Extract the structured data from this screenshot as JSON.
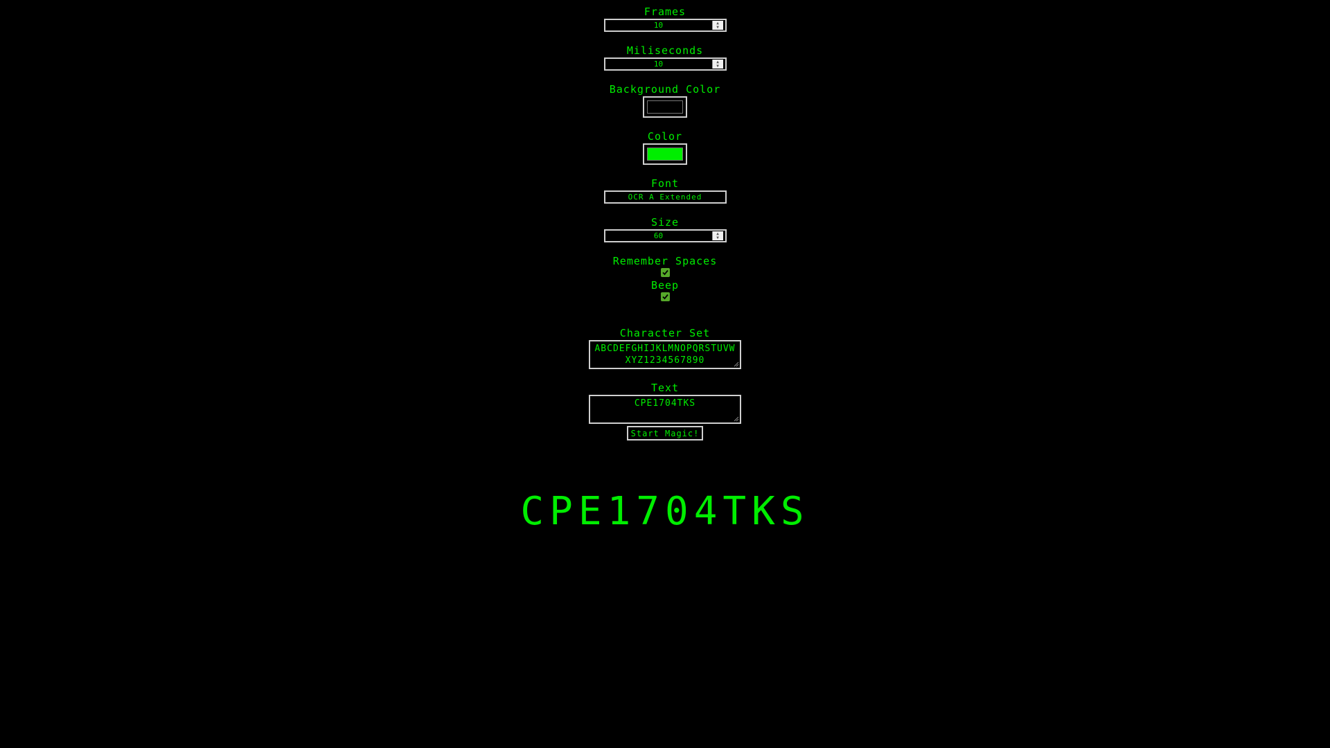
{
  "colors": {
    "background": "#000000",
    "accent": "#00ee00",
    "checkbox": "#56a82a"
  },
  "frames": {
    "label": "Frames",
    "value": "10"
  },
  "milliseconds": {
    "label": "Miliseconds",
    "value": "10"
  },
  "background_color": {
    "label": "Background Color",
    "value": "#000000"
  },
  "color": {
    "label": "Color",
    "value": "#00ee00"
  },
  "font": {
    "label": "Font",
    "value": "OCR A Extended"
  },
  "size": {
    "label": "Size",
    "value": "60"
  },
  "remember_spaces": {
    "label": "Remember Spaces",
    "checked": true
  },
  "beep": {
    "label": "Beep",
    "checked": true
  },
  "character_set": {
    "label": "Character Set",
    "value": "ABCDEFGHIJKLMNOPQRSTUVWXYZ1234567890"
  },
  "text": {
    "label": "Text",
    "value": "CPE1704TKS"
  },
  "start_button": {
    "label": "Start Magic!"
  },
  "output": {
    "text": "CPE1704TKS"
  },
  "icons": {
    "stepper": "spinner-arrows-icon",
    "check": "checkmark-icon",
    "resize": "resize-grip-icon"
  }
}
